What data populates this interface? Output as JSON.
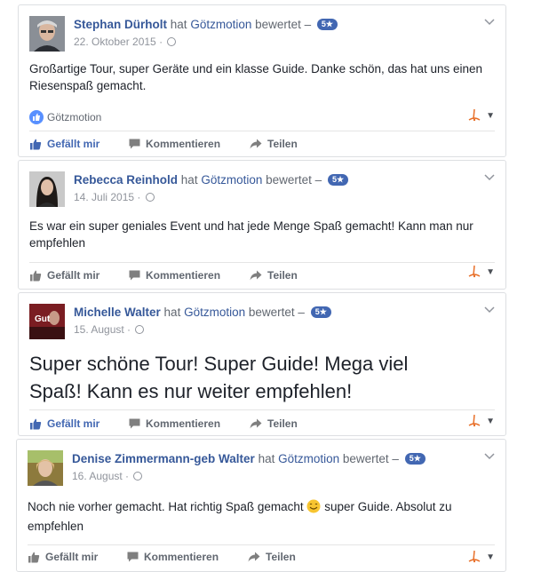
{
  "reviews": [
    {
      "author": "Stephan Dürholt",
      "verb": "hat",
      "page": "Götzmotion",
      "action": "bewertet –",
      "rating": "5★",
      "date": "22. Oktober 2015 ·",
      "text": "Großartige Tour, super Geräte und ein klasse Guide. Danke schön, das hat uns einen Riesenspaß gemacht.",
      "liked_by": "Götzmotion",
      "like_label": "Gefällt mir",
      "comment_label": "Kommentieren",
      "share_label": "Teilen"
    },
    {
      "author": "Rebecca Reinhold",
      "verb": "hat",
      "page": "Götzmotion",
      "action": "bewertet –",
      "rating": "5★",
      "date": "14. Juli 2015 ·",
      "text": "Es war ein super geniales Event und hat jede Menge Spaß gemacht! Kann man nur empfehlen",
      "like_label": "Gefällt mir",
      "comment_label": "Kommentieren",
      "share_label": "Teilen"
    },
    {
      "author": "Michelle Walter",
      "verb": "hat",
      "page": "Götzmotion",
      "action": "bewertet –",
      "rating": "5★",
      "date": "15. August ·",
      "avatar_text": "Gut",
      "text": "Super schöne Tour! Super Guide! Mega viel Spaß! Kann es nur weiter empfehlen!",
      "like_label": "Gefällt mir",
      "comment_label": "Kommentieren",
      "share_label": "Teilen"
    },
    {
      "author": "Denise Zimmermann-geb Walter",
      "verb": "hat",
      "page": "Götzmotion",
      "action": "bewertet –",
      "rating": "5★",
      "date": "16. August ·",
      "text_before": "Noch nie vorher gemacht. Hat richtig Spaß gemacht",
      "text_after": "super Guide. Absolut zu empfehlen",
      "like_label": "Gefällt mir",
      "comment_label": "Kommentieren",
      "share_label": "Teilen"
    }
  ],
  "colors": {
    "link": "#365899",
    "badge": "#4267b2",
    "like_blue": "#5890ff",
    "muted": "#616770",
    "meta": "#90949c"
  },
  "icons": [
    "thumbs-up-icon",
    "comment-icon",
    "share-icon",
    "globe-icon",
    "chevron-down-icon",
    "like-circle-icon",
    "smiley-icon",
    "page-switcher-icon"
  ]
}
